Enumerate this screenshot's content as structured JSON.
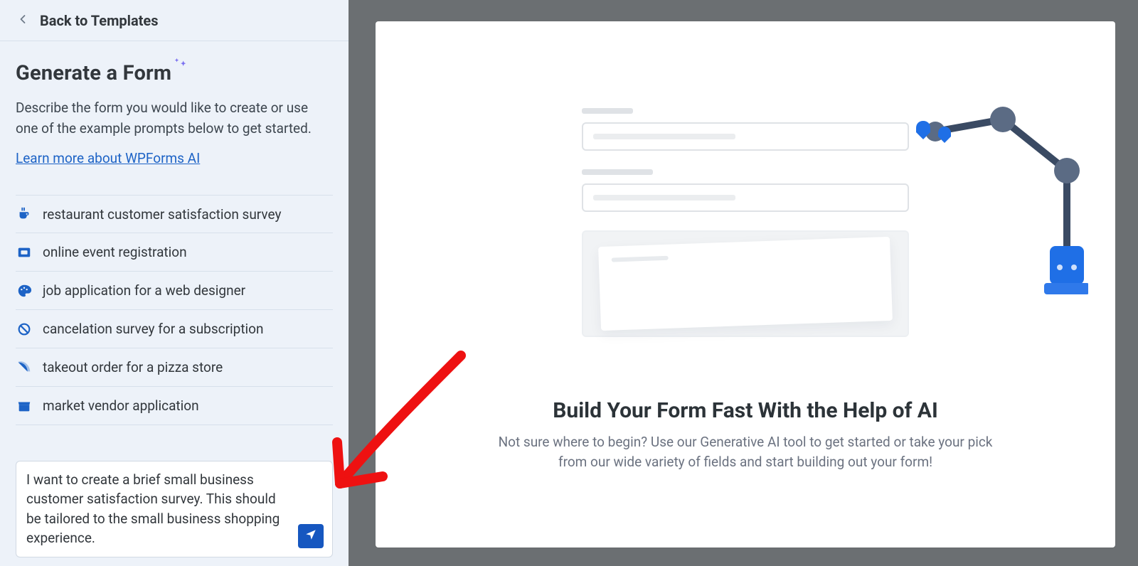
{
  "back_label": "Back to Templates",
  "title": "Generate a Form",
  "description": "Describe the form you would like to create or use one of the example prompts below to get started.",
  "learn_more": "Learn more about WPForms AI",
  "prompts": [
    "restaurant customer satisfaction survey",
    "online event registration",
    "job application for a web designer",
    "cancelation survey for a subscription",
    "takeout order for a pizza store",
    "market vendor application"
  ],
  "composer": {
    "value": "I want to create a brief small business customer satisfaction survey. This should be tailored to the small business shopping experience."
  },
  "preview": {
    "headline": "Build Your Form Fast With the Help of AI",
    "subtext": "Not sure where to begin? Use our Generative AI tool to get started or take your pick from our wide variety of fields and start building out your form!"
  },
  "colors": {
    "accent": "#1d63c6"
  }
}
